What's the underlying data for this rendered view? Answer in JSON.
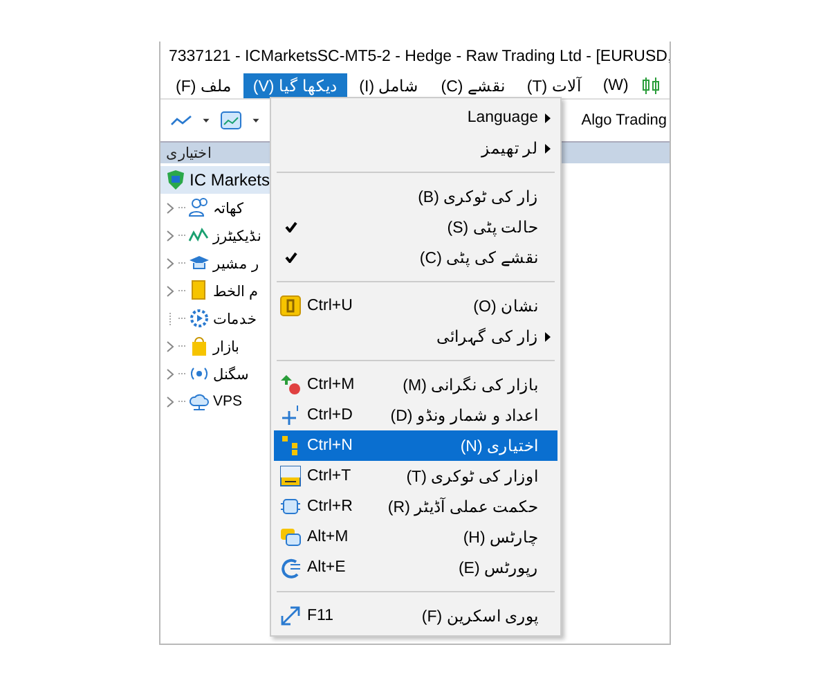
{
  "window": {
    "title": "7337121 - ICMarketsSC-MT5-2 - Hedge - Raw Trading Ltd - [EURUSD,"
  },
  "menu_bar": [
    {
      "label": "(W)",
      "selected": false
    },
    {
      "label": "آلات (T)",
      "selected": false
    },
    {
      "label": "نقشے (C)",
      "selected": false
    },
    {
      "label": "شامل (I)",
      "selected": false
    },
    {
      "label": "دیکھا گیا (V)",
      "selected": true
    },
    {
      "label": "ملف (F)",
      "selected": false
    }
  ],
  "toolbar": {
    "algo_trading": "Algo Trading"
  },
  "navigator": {
    "title": "اختیاری",
    "root": {
      "label": "IC Markets",
      "expanded": true,
      "children": [
        {
          "label": "کھاتہ",
          "expandable": true
        },
        {
          "label": "نڈیکیٹرز",
          "expandable": true
        },
        {
          "label": "ر مشیر",
          "expandable": true
        },
        {
          "label": "م الخط",
          "expandable": true
        },
        {
          "label": "خدمات",
          "expandable": false
        },
        {
          "label": "بازار",
          "expandable": true
        },
        {
          "label": "سگنل",
          "expandable": true
        },
        {
          "label": "VPS",
          "expandable": true
        }
      ]
    }
  },
  "view_menu": [
    {
      "kind": "item",
      "label": "Language",
      "submenu": true,
      "checked": false,
      "selected": false
    },
    {
      "kind": "item",
      "label": "لر تهیمز",
      "submenu": true,
      "checked": false,
      "selected": false
    },
    {
      "kind": "separator"
    },
    {
      "kind": "item",
      "label": "زار کی ٹوکری (B)",
      "submenu": false,
      "checked": false,
      "selected": false
    },
    {
      "kind": "item",
      "label": "حالت پٹی (S)",
      "submenu": false,
      "checked": true,
      "selected": false
    },
    {
      "kind": "item",
      "label": "نقشے کی پٹی (C)",
      "submenu": false,
      "checked": true,
      "selected": false
    },
    {
      "kind": "separator"
    },
    {
      "kind": "item",
      "label": "نشان (O)",
      "shortcut": "Ctrl+U",
      "submenu": false,
      "checked": false,
      "selected": false
    },
    {
      "kind": "item",
      "label": "زار کی گہرائی",
      "submenu": true,
      "checked": false,
      "selected": false
    },
    {
      "kind": "separator"
    },
    {
      "kind": "item",
      "label": "بازار کی نگرانی (M)",
      "shortcut": "Ctrl+M",
      "submenu": false,
      "checked": false,
      "selected": false
    },
    {
      "kind": "item",
      "label": "اعداد و شمار ونڈو (D)",
      "shortcut": "Ctrl+D",
      "submenu": false,
      "checked": false,
      "selected": false
    },
    {
      "kind": "item",
      "label": "اختیاری (N)",
      "shortcut": "Ctrl+N",
      "submenu": false,
      "checked": false,
      "selected": true
    },
    {
      "kind": "item",
      "label": "اوزار کی ٹوکری (T)",
      "shortcut": "Ctrl+T",
      "submenu": false,
      "checked": false,
      "selected": false
    },
    {
      "kind": "item",
      "label": "حکمت عملی آڈیٹر (R)",
      "shortcut": "Ctrl+R",
      "submenu": false,
      "checked": false,
      "selected": false
    },
    {
      "kind": "item",
      "label": "چارٹس (H)",
      "shortcut": "Alt+M",
      "submenu": false,
      "checked": false,
      "selected": false
    },
    {
      "kind": "item",
      "label": "رپورٹس (E)",
      "shortcut": "Alt+E",
      "submenu": false,
      "checked": false,
      "selected": false
    },
    {
      "kind": "separator"
    },
    {
      "kind": "item",
      "label": "پوری اسکرین (F)",
      "shortcut": "F11",
      "submenu": false,
      "checked": false,
      "selected": false
    }
  ]
}
